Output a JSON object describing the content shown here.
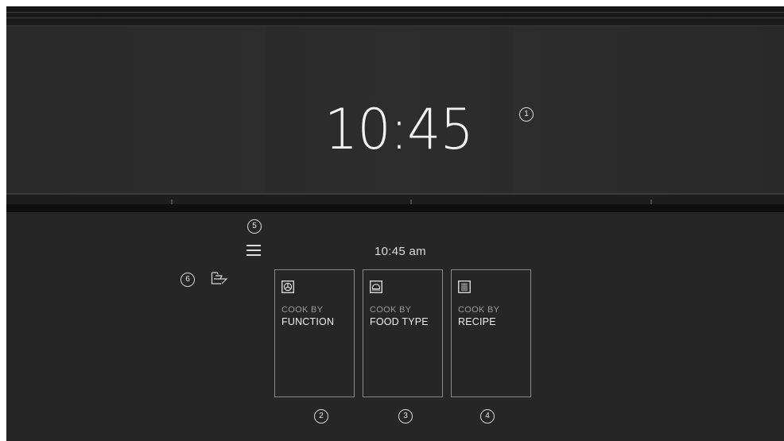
{
  "display": {
    "clock": "10:45"
  },
  "panel": {
    "time": "10:45 am",
    "cards": [
      {
        "top": "COOK BY",
        "bottom": "FUNCTION",
        "icon": "fan-oven-icon"
      },
      {
        "top": "COOK BY",
        "bottom": "FOOD TYPE",
        "icon": "dish-cover-icon"
      },
      {
        "top": "COOK BY",
        "bottom": "RECIPE",
        "icon": "recipe-list-icon"
      }
    ],
    "menu_icon": "hamburger-menu-icon",
    "favorites_icon": "favorites-folder-icon"
  },
  "callouts": [
    "1",
    "2",
    "3",
    "4",
    "5",
    "6"
  ],
  "colors": {
    "background": "#262626",
    "text": "#f0f0f0",
    "card_border": "#8a8a8a",
    "muted_text": "#9a9a9a"
  }
}
